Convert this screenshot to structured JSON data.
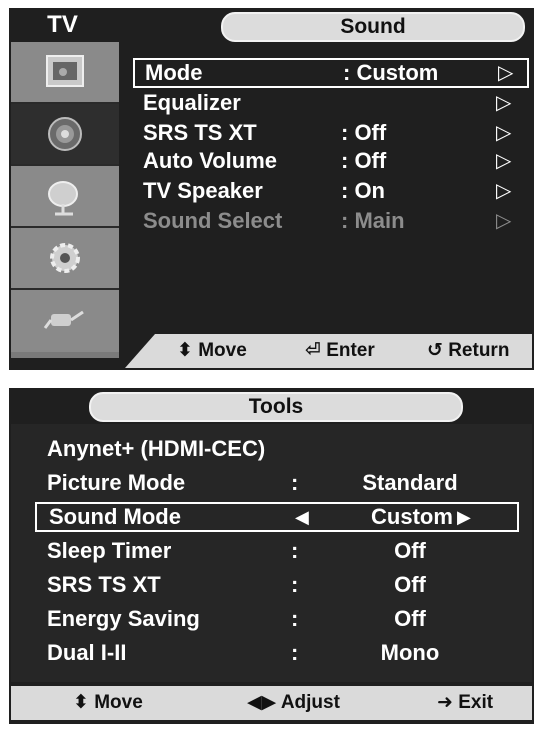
{
  "sound_menu": {
    "tv_label": "TV",
    "title": "Sound",
    "sidebar_icons": [
      "picture-icon",
      "sound-icon",
      "channel-icon",
      "setup-icon",
      "input-icon"
    ],
    "items": [
      {
        "label": "Mode",
        "value": ": Custom",
        "arrow": "▷"
      },
      {
        "label": "Equalizer",
        "value": "",
        "arrow": "▷"
      },
      {
        "label": "SRS TS XT",
        "value": ": Off",
        "arrow": "▷"
      },
      {
        "label": "Auto Volume",
        "value": ": Off",
        "arrow": "▷"
      },
      {
        "label": "TV Speaker",
        "value": ": On",
        "arrow": "▷"
      },
      {
        "label": "Sound Select",
        "value": ": Main",
        "arrow": "▷"
      }
    ],
    "bottom": {
      "move": "Move",
      "enter": "Enter",
      "return": "Return",
      "move_icon": "⬍",
      "enter_icon": "⏎",
      "return_icon": "↺"
    }
  },
  "tools_menu": {
    "title": "Tools",
    "items": [
      {
        "label": "Anynet+ (HDMI-CEC)",
        "colon": "",
        "value": ""
      },
      {
        "label": "Picture Mode",
        "colon": ":",
        "value": "Standard"
      },
      {
        "label": "Sound Mode",
        "colon": "",
        "value": "Custom",
        "left": "◀",
        "right": "▶"
      },
      {
        "label": "Sleep Timer",
        "colon": ":",
        "value": "Off"
      },
      {
        "label": "SRS TS XT",
        "colon": ":",
        "value": "Off"
      },
      {
        "label": "Energy Saving",
        "colon": ":",
        "value": "Off"
      },
      {
        "label": "Dual I-II",
        "colon": ":",
        "value": "Mono"
      }
    ],
    "bottom": {
      "move": "Move",
      "adjust": "Adjust",
      "exit": "Exit",
      "move_icon": "⬍",
      "adjust_icon": "◀▶",
      "exit_icon": "➜"
    }
  }
}
